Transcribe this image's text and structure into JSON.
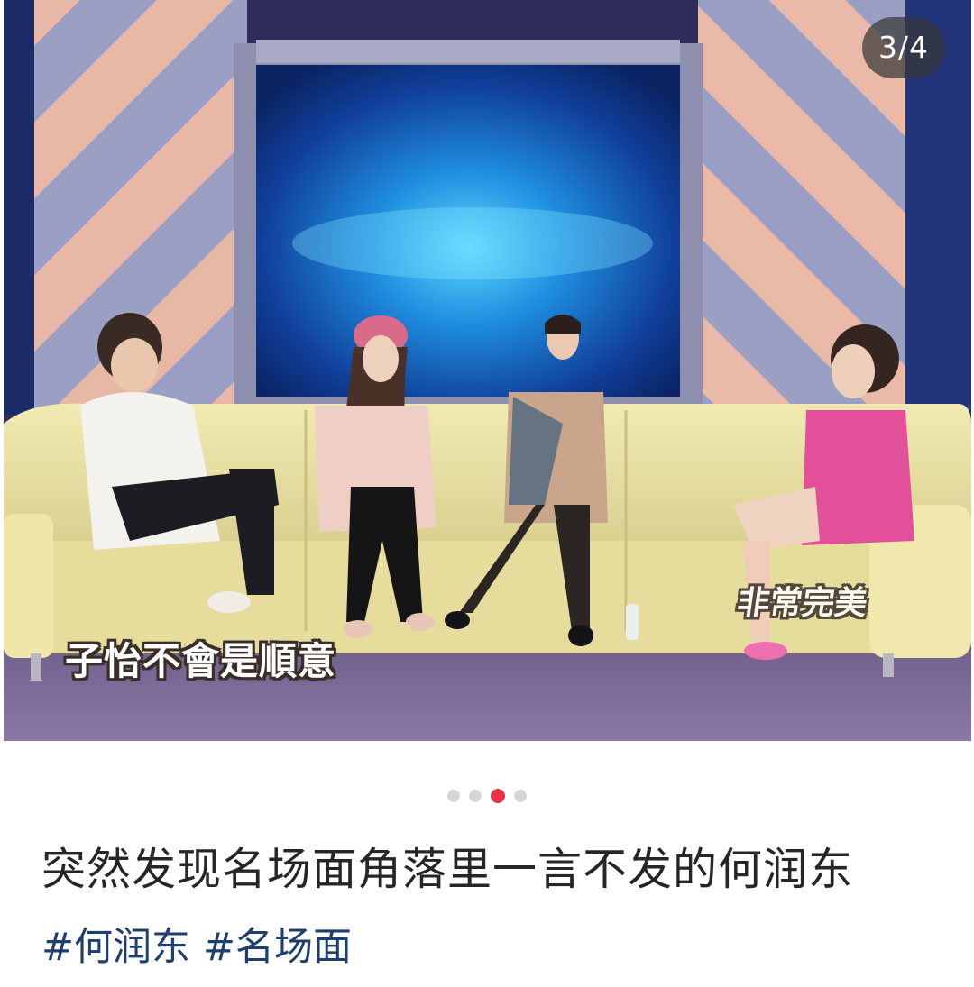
{
  "carousel": {
    "counter": "3/4",
    "subtitle": "子怡不會是順意",
    "logo_text": "非常完美",
    "pages": [
      {
        "active": false
      },
      {
        "active": false
      },
      {
        "active": true
      },
      {
        "active": false
      }
    ],
    "colors": {
      "dot_active": "#e8324b",
      "dot_inactive": "#d6d6d6",
      "counter_bg": "#373737"
    }
  },
  "post": {
    "title": "突然发现名场面角落里一言不发的何润东",
    "tags": [
      "#何润东",
      "#名场面"
    ],
    "colors": {
      "title": "#262626",
      "tag": "#1f3f6e"
    }
  }
}
